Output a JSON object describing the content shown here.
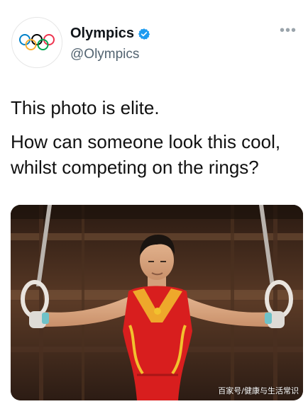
{
  "account": {
    "name": "Olympics",
    "handle": "@Olympics",
    "verified": true,
    "avatar_icon": "olympic-rings-icon"
  },
  "menu_icon": "more-options-icon",
  "tweet": {
    "line1": "This photo is elite.",
    "line2": "How can someone look this cool, whilst competing on the rings?"
  },
  "media": {
    "type": "photo",
    "watermark": "百家号/健康与生活常识"
  },
  "colors": {
    "verified_blue": "#1d9bf0",
    "ring_blue": "#0081c8",
    "ring_yellow": "#fcb131",
    "ring_black": "#000000",
    "ring_green": "#00a651",
    "ring_red": "#ee334e",
    "uniform_red": "#d81e1e",
    "uniform_gold": "#f2c12e"
  }
}
